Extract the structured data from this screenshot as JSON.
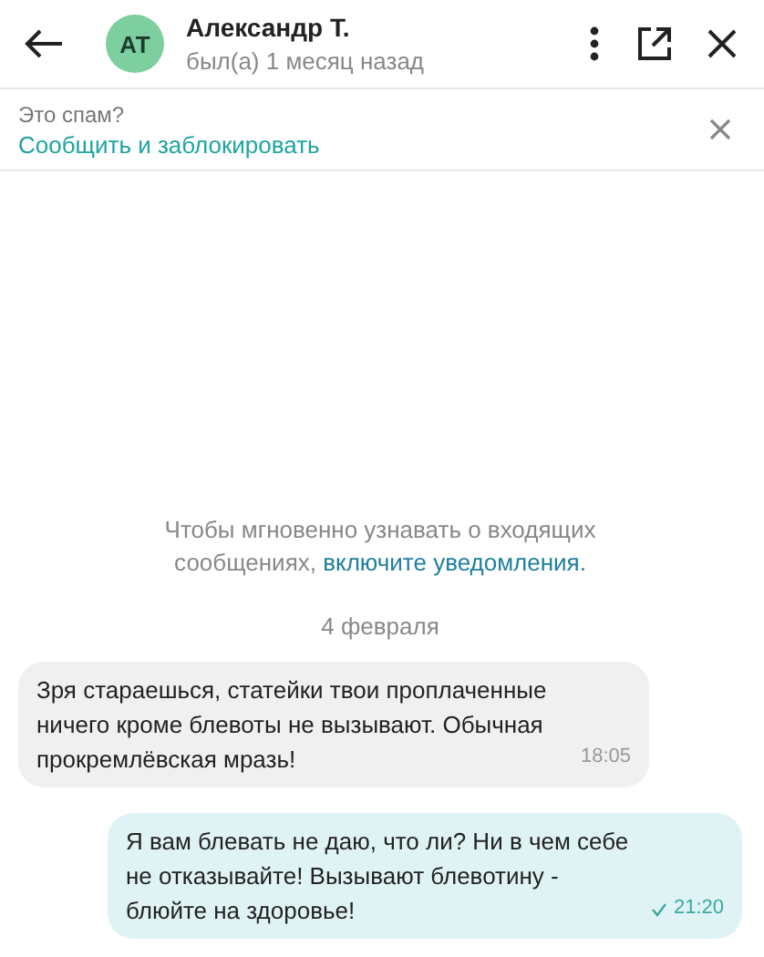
{
  "header": {
    "avatar_initials": "АТ",
    "name": "Александр Т.",
    "status": "был(а) 1 месяц назад"
  },
  "spam_bar": {
    "question": "Это спам?",
    "action": "Сообщить и заблокировать"
  },
  "notice": {
    "text": "Чтобы мгновенно узнавать о входящих сообщениях, ",
    "link": "включите уведомления."
  },
  "date_separator": "4 февраля",
  "messages": [
    {
      "kind": "incoming",
      "text": "Зря стараешься, статейки твои проплаченные ничего кроме блевоты не вызывают. Обычная прокремлёвская мразь!",
      "time": "18:05"
    },
    {
      "kind": "outgoing",
      "text": "Я вам блевать не даю, что ли? Ни в чем себе не отказывайте! Вызывают блевотину - блюйте на здоровье!",
      "time": "21:20"
    }
  ]
}
